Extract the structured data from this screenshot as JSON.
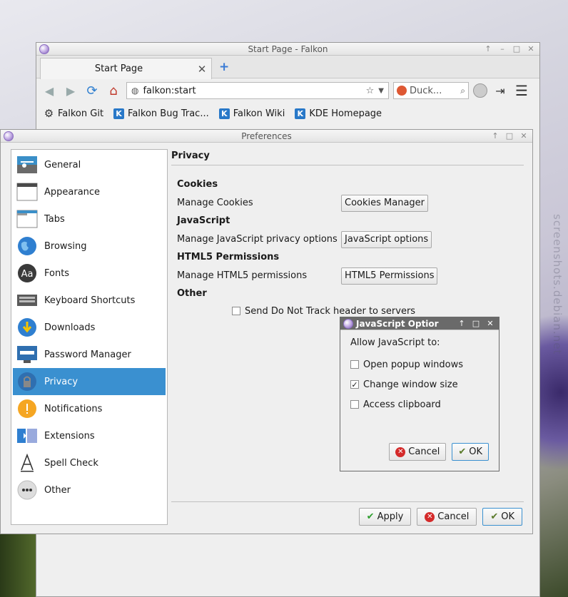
{
  "browser": {
    "title": "Start Page - Falkon",
    "tab": {
      "label": "Start Page"
    },
    "url": "falkon:start",
    "search_placeholder": "Duck...",
    "bookmarks": [
      {
        "label": "Falkon Git",
        "icon": "gear-icon"
      },
      {
        "label": "Falkon Bug Trac...",
        "icon": "kde-icon"
      },
      {
        "label": "Falkon Wiki",
        "icon": "kde-icon"
      },
      {
        "label": "KDE Homepage",
        "icon": "kde-icon"
      }
    ]
  },
  "prefs": {
    "title": "Preferences",
    "sidebar": [
      {
        "label": "General",
        "icon": "general-icon"
      },
      {
        "label": "Appearance",
        "icon": "appearance-icon"
      },
      {
        "label": "Tabs",
        "icon": "tabs-icon"
      },
      {
        "label": "Browsing",
        "icon": "globe-icon"
      },
      {
        "label": "Fonts",
        "icon": "fonts-icon"
      },
      {
        "label": "Keyboard Shortcuts",
        "icon": "keyboard-icon"
      },
      {
        "label": "Downloads",
        "icon": "downloads-icon"
      },
      {
        "label": "Password Manager",
        "icon": "password-icon"
      },
      {
        "label": "Privacy",
        "icon": "privacy-icon",
        "active": true
      },
      {
        "label": "Notifications",
        "icon": "notifications-icon"
      },
      {
        "label": "Extensions",
        "icon": "extensions-icon"
      },
      {
        "label": "Spell Check",
        "icon": "spellcheck-icon"
      },
      {
        "label": "Other",
        "icon": "other-icon"
      }
    ],
    "privacy": {
      "heading": "Privacy",
      "cookies_title": "Cookies",
      "manage_cookies_label": "Manage Cookies",
      "cookies_button": "Cookies Manager",
      "js_title": "JavaScript",
      "js_label": "Manage JavaScript privacy options",
      "js_button": "JavaScript options",
      "html5_title": "HTML5 Permissions",
      "html5_label": "Manage HTML5 permissions",
      "html5_button": "HTML5 Permissions",
      "other_title": "Other",
      "dnt_label": "Send Do Not Track header to servers"
    },
    "buttons": {
      "apply": "Apply",
      "cancel": "Cancel",
      "ok": "OK"
    }
  },
  "js_dialog": {
    "title": "JavaScript Optior",
    "intro": "Allow JavaScript to:",
    "options": [
      {
        "label": "Open popup windows",
        "checked": false
      },
      {
        "label": "Change window size",
        "checked": true
      },
      {
        "label": "Access clipboard",
        "checked": false
      }
    ],
    "cancel": "Cancel",
    "ok": "OK"
  }
}
